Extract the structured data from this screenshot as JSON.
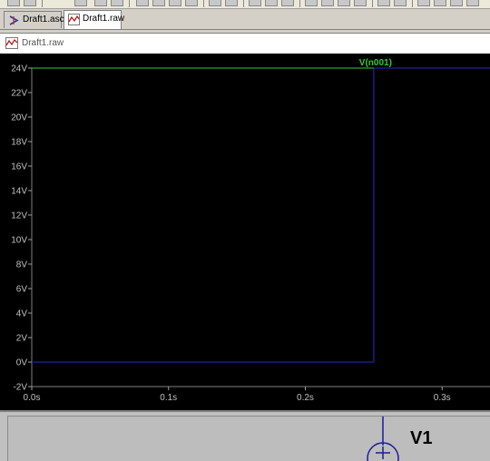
{
  "tabs": [
    {
      "label": "Draft1.asc",
      "icon": "schematic-icon",
      "active": false
    },
    {
      "label": "Draft1.raw",
      "icon": "waveform-icon",
      "active": true
    }
  ],
  "plot_window": {
    "title": "Draft1.raw"
  },
  "chart_data": {
    "type": "line",
    "series": [
      {
        "name": "V(n001)",
        "color": "#33cc33",
        "x": [
          0.0,
          0.25,
          0.25,
          0.35
        ],
        "y": [
          0,
          0,
          24,
          24
        ]
      }
    ],
    "trace_color": "#1a1a8c",
    "label_color": "#33cc33",
    "xlim": [
      0.0,
      0.335
    ],
    "ylim": [
      -2,
      24
    ],
    "x_ticks": [
      0.0,
      0.1,
      0.2,
      0.3
    ],
    "x_tick_labels": [
      "0.0s",
      "0.1s",
      "0.2s",
      "0.3s"
    ],
    "y_ticks": [
      -2,
      0,
      2,
      4,
      6,
      8,
      10,
      12,
      14,
      16,
      18,
      20,
      22,
      24
    ],
    "y_tick_labels": [
      "-2V",
      "0V",
      "2V",
      "4V",
      "6V",
      "8V",
      "10V",
      "12V",
      "14V",
      "16V",
      "18V",
      "20V",
      "22V",
      "24V"
    ],
    "grid": false
  },
  "schematic": {
    "component_label": "V1"
  }
}
